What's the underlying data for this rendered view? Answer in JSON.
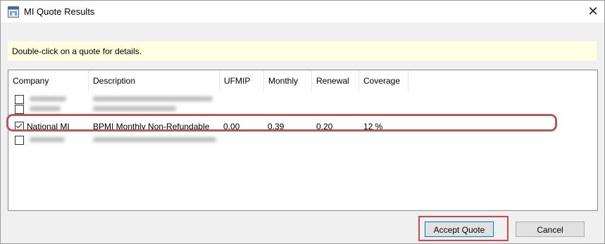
{
  "window": {
    "title": "MI Quote Results",
    "close_glyph": "✕"
  },
  "hint": {
    "text": "Double-click on a quote for details."
  },
  "table": {
    "columns": [
      "Company",
      "Description",
      "UFMIP",
      "Monthly",
      "Renewal",
      "Coverage"
    ],
    "rows": [
      {
        "checked": false,
        "redacted": true
      },
      {
        "checked": false,
        "redacted": true
      },
      {
        "checked": true,
        "redacted": false,
        "company": "National MI",
        "description": "BPMI Monthly Non-Refundable",
        "ufmip": "0.00",
        "monthly": "0.39",
        "renewal": "0.20",
        "coverage": "12 %"
      },
      {
        "checked": false,
        "redacted": true
      }
    ]
  },
  "buttons": {
    "accept": "Accept Quote",
    "cancel": "Cancel"
  },
  "colors": {
    "highlight": "#b5585a",
    "hint_bg": "#ffffe1",
    "accept_outline": "#c64b51"
  }
}
